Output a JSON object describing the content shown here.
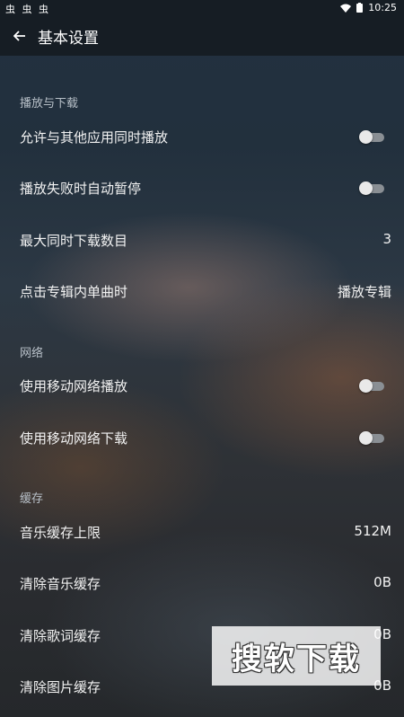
{
  "status_bar": {
    "left_icons": "虫 虫 虫",
    "notification_icon": "a-notification-icon",
    "time": "10:25"
  },
  "appbar": {
    "back_icon": "arrow-left-icon",
    "title": "基本设置"
  },
  "sections": [
    {
      "title": "播放与下载",
      "rows": [
        {
          "label": "允许与其他应用同时播放",
          "type": "toggle",
          "on": false
        },
        {
          "label": "播放失败时自动暂停",
          "type": "toggle",
          "on": false
        },
        {
          "label": "最大同时下载数目",
          "type": "value",
          "value": "3"
        },
        {
          "label": "点击专辑内单曲时",
          "type": "value",
          "value": "播放专辑"
        }
      ]
    },
    {
      "title": "网络",
      "rows": [
        {
          "label": "使用移动网络播放",
          "type": "toggle",
          "on": false
        },
        {
          "label": "使用移动网络下载",
          "type": "toggle",
          "on": false
        }
      ]
    },
    {
      "title": "缓存",
      "rows": [
        {
          "label": "音乐缓存上限",
          "type": "value",
          "value": "512M"
        },
        {
          "label": "清除音乐缓存",
          "type": "value",
          "value": "0B"
        },
        {
          "label": "清除歌词缓存",
          "type": "value",
          "value": "0B"
        },
        {
          "label": "清除图片缓存",
          "type": "value",
          "value": "0B"
        }
      ]
    }
  ],
  "watermark": "搜软下载"
}
